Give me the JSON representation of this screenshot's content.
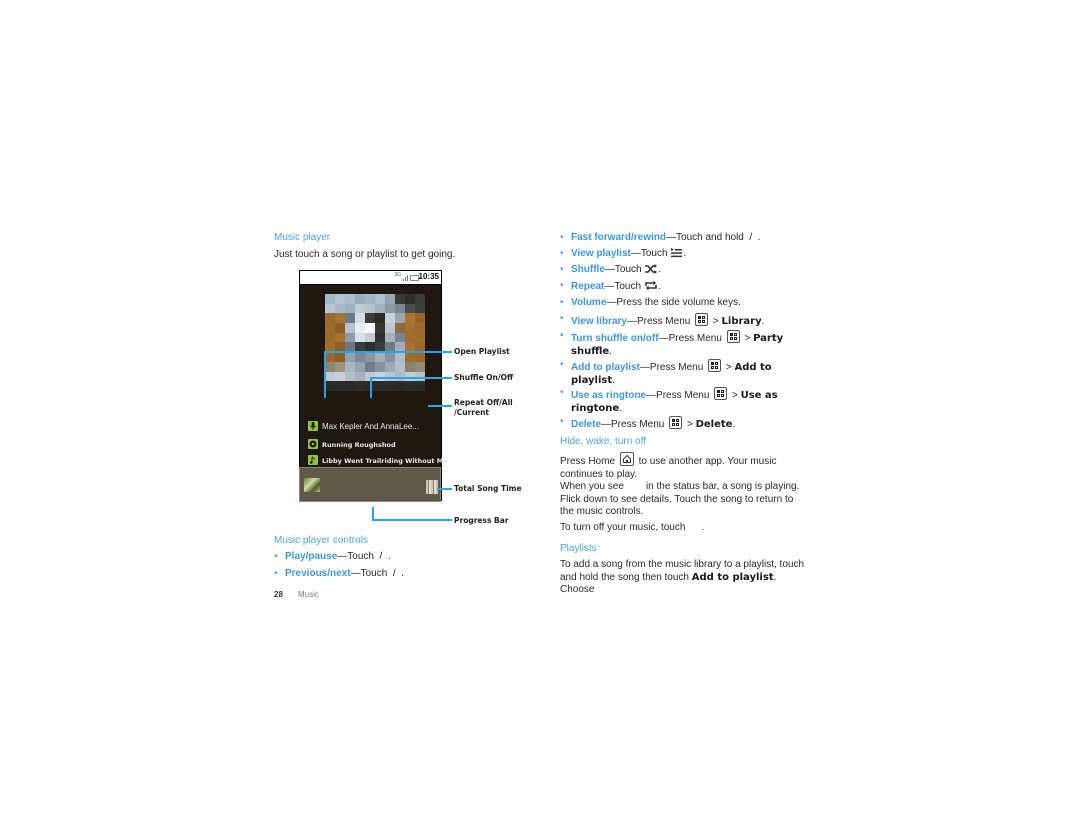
{
  "left": {
    "section_heading": "Music player",
    "intro": "Just touch a song or playlist to get going.",
    "phone": {
      "status_network": "3G",
      "clock": "10:35",
      "tracks": [
        {
          "icon": "artist-icon",
          "label": "Max Kepler And AnnaLee..."
        },
        {
          "icon": "album-icon",
          "label": "Running Roughshod"
        },
        {
          "icon": "song-icon",
          "label": "Libby Went Trailriding Without  Me"
        }
      ]
    },
    "callouts": {
      "open_playlist": "Open Playlist",
      "shuffle": "Shuffle On/Off",
      "repeat_line1": "Repeat Off/All",
      "repeat_line2": "/Current",
      "total_time": "Total Song Time",
      "progress_bar": "Progress Bar"
    },
    "controls_heading": "Music player controls",
    "controls": [
      {
        "term": "Play/pause",
        "text": "—Touch",
        "tail": "  /  ."
      },
      {
        "term": "Previous/next",
        "text": "—Touch",
        "tail": "  /  ."
      }
    ]
  },
  "right": {
    "bullets": [
      {
        "term": "Fast forward/rewind",
        "text": "—Touch and hold",
        "tail": "  /  ."
      },
      {
        "term": "View playlist",
        "text": "—Touch",
        "icon": "playlist-icon",
        "tail": "."
      },
      {
        "term": "Shuffle",
        "text": "—Touch",
        "icon": "shuffle-icon",
        "tail": "."
      },
      {
        "term": "Repeat",
        "text": "—Touch",
        "icon": "repeat-icon",
        "tail": "."
      },
      {
        "term": "Volume",
        "text": "—Press the side volume keys."
      },
      {
        "term": "View library",
        "text": "—Press Menu",
        "gt": ">",
        "ui": "Library",
        "tail": "."
      },
      {
        "term": "Turn shuffle on/off",
        "text": "—Press Menu",
        "gt": ">",
        "ui": "Party",
        "ui2": "shuffle",
        "tail": "."
      },
      {
        "term": "Add to playlist",
        "text": "—Press Menu",
        "gt": ">",
        "ui": "Add to",
        "ui2": "playlist",
        "tail": "."
      },
      {
        "term": "Use as ringtone",
        "text": "—Press Menu",
        "gt": ">",
        "ui": "Use as",
        "ui2": "ringtone",
        "tail": "."
      },
      {
        "term": "Delete",
        "text": "—Press Menu",
        "gt": ">",
        "ui": "Delete",
        "tail": "."
      }
    ],
    "hide_heading": "Hide, wake, turn off",
    "hide_p1a": "Press Home",
    "hide_p1b": "to use another app. Your music",
    "hide_p1c": "continues to play.",
    "hide_p2a": "When you see",
    "hide_p2b": "in the status bar, a song is playing.",
    "hide_p2c": "Flick down to see details. Touch the song to return to",
    "hide_p2d": "the music controls.",
    "hide_p3": "To turn off your music, touch",
    "hide_p3_tail": ".",
    "playlists_heading": "Playlists",
    "playlists_p1": "To add a song from the music library to a playlist, touch",
    "playlists_p2a": "and hold the song then touch",
    "playlists_p2_ui": "Add to playlist",
    "playlists_p2b": ". Choose"
  },
  "footer": {
    "page_number": "28",
    "section": "Music"
  },
  "colors": {
    "accent": "#4da3e6",
    "callout_line": "#2aa4e8",
    "phone_bg": "#1e1810",
    "icon_green": "#8cc63f"
  }
}
